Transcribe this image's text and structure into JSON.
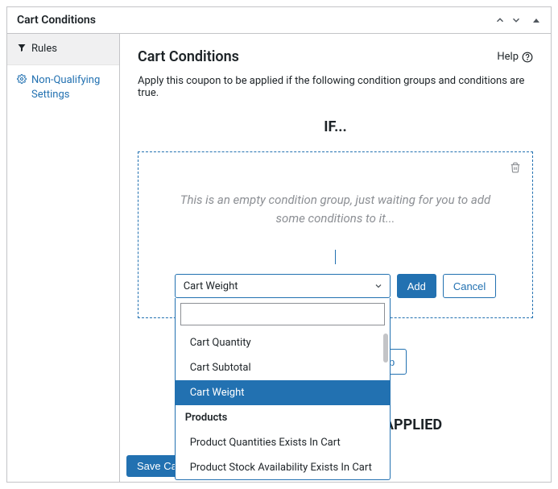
{
  "panel": {
    "title": "Cart Conditions"
  },
  "sidebar": {
    "items": [
      {
        "label": "Rules"
      },
      {
        "label": "Non-Qualifying Settings"
      }
    ]
  },
  "main": {
    "title": "Cart Conditions",
    "help_label": "Help",
    "description": "Apply this coupon to be applied if the following condition groups and conditions are true.",
    "if_heading": "IF...",
    "empty_group_msg": "This is an empty condition group, just waiting for you to add some conditions to it...",
    "add_btn": "Add",
    "cancel_btn": "Cancel",
    "add_group_btn": "Add a New 'OR' Group",
    "applied_heading": "THIS COUPON WILL BE APPLIED",
    "save_btn": "Save Cart Conditions"
  },
  "select": {
    "selected_label": "Cart Weight",
    "search_value": "",
    "options": [
      {
        "type": "option",
        "label": "Cart Quantity"
      },
      {
        "type": "option",
        "label": "Cart Subtotal"
      },
      {
        "type": "option",
        "label": "Cart Weight",
        "highlighted": true
      },
      {
        "type": "group",
        "label": "Products"
      },
      {
        "type": "option",
        "label": "Product Quantities Exists In Cart"
      },
      {
        "type": "option",
        "label": "Product Stock Availability Exists In Cart"
      }
    ]
  }
}
